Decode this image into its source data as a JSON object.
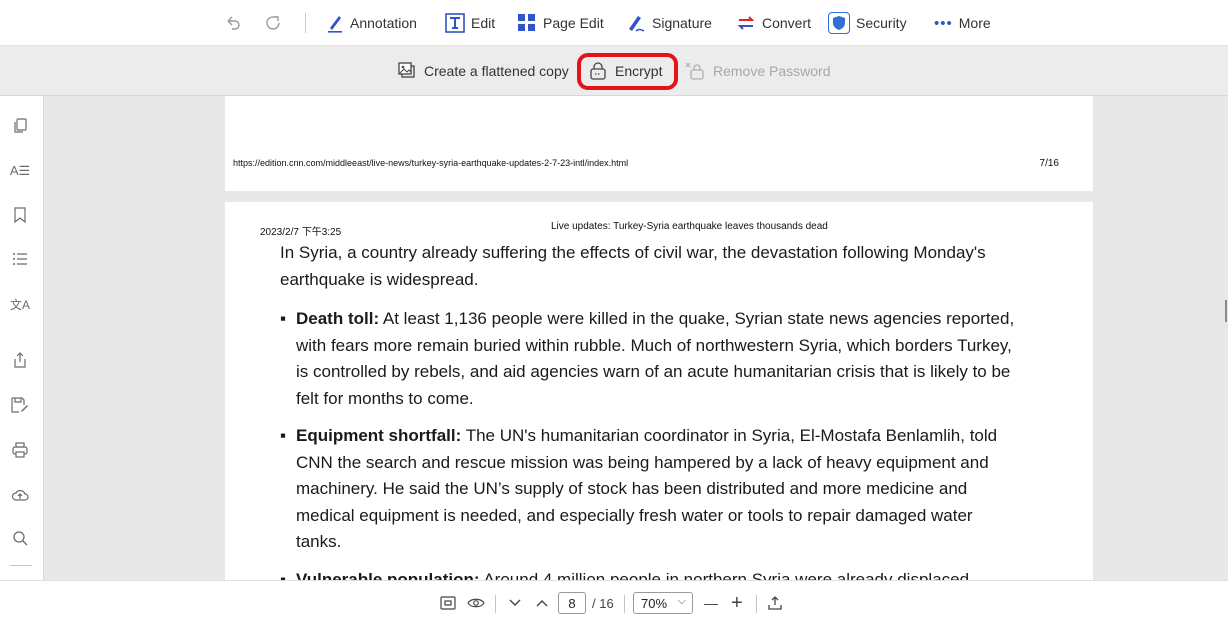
{
  "toolbar": {
    "undo_icon": "undo-icon",
    "redo_icon": "redo-icon",
    "annotation": "Annotation",
    "edit": "Edit",
    "page_edit": "Page Edit",
    "signature": "Signature",
    "convert": "Convert",
    "security": "Security",
    "more": "More"
  },
  "security_bar": {
    "flatten": "Create a flattened copy",
    "encrypt": "Encrypt",
    "remove_password": "Remove Password"
  },
  "sidebar": {
    "items": [
      "pages-icon",
      "text-format-icon",
      "bookmark-icon",
      "outline-list-icon",
      "translate-icon",
      "share-icon",
      "save-as-icon",
      "print-icon",
      "cloud-upload-icon",
      "search-icon"
    ]
  },
  "document": {
    "page7_url": "https://edition.cnn.com/middleeast/live-news/turkey-syria-earthquake-updates-2-7-23-intl/index.html",
    "page7_number": "7/16",
    "page8_date": "2023/2/7 下午3:25",
    "page8_title": "Live updates: Turkey-Syria earthquake leaves thousands dead",
    "intro": "In Syria, a country already suffering the effects of civil war, the devastation following Monday's earthquake is widespread.",
    "bullets": [
      {
        "head": "Death toll:",
        "text": " At least 1,136 people were killed in the quake, Syrian state news agencies reported, with fears more remain buried within rubble. Much of northwestern Syria, which borders Turkey, is controlled by rebels, and aid agencies warn of an acute humanitarian crisis that is likely to be felt for months to come."
      },
      {
        "head": "Equipment shortfall:",
        "text": " The UN's humanitarian coordinator in Syria, El-Mostafa Benlamlih, told CNN the search and rescue mission was being hampered by a lack of heavy equipment and machinery. He said the UN’s supply of stock has been distributed and more medicine and medical equipment is needed, and especially fresh water or tools to repair damaged water tanks."
      },
      {
        "head": "Vulnerable population:",
        "text": " Around 4 million people in northern Syria were already displaced"
      }
    ],
    "bullet_char": "▪"
  },
  "bottom": {
    "current_page": "8",
    "total_pages": "/ 16",
    "zoom": "70%",
    "zoom_out": "—",
    "zoom_in": "+"
  },
  "colors": {
    "highlight": "#e3121b",
    "security_accent": "#2f6fd6"
  }
}
